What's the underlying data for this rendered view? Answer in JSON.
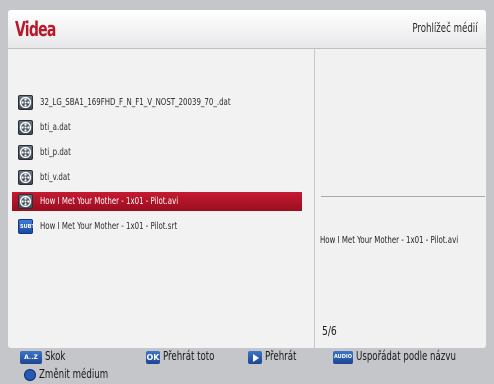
{
  "header": {
    "title": "Videa",
    "subtitle": "Prohlížeč médií"
  },
  "files": [
    {
      "name": "32_LG_SBA1_169FHD_F_N_F1_V_NOST_20039_70_.dat",
      "icon": "film-reel-icon",
      "selected": false
    },
    {
      "name": "bti_a.dat",
      "icon": "film-reel-icon",
      "selected": false
    },
    {
      "name": "bti_p.dat",
      "icon": "film-reel-icon",
      "selected": false
    },
    {
      "name": "bti_v.dat",
      "icon": "film-reel-icon",
      "selected": false
    },
    {
      "name": "How I Met Your Mother - 1x01 - Pilot.avi",
      "icon": "film-reel-icon",
      "selected": true
    },
    {
      "name": "How I Met Your Mother - 1x01 - Pilot.srt",
      "icon": "subtitle-icon",
      "selected": false
    }
  ],
  "subtitle_icon_text": "SUBT",
  "preview": {
    "name": "How I Met Your Mother - 1x01 - Pilot.avi",
    "counter": "5/6"
  },
  "footer": {
    "skip_badge": "A..Z",
    "skip_label": "Skok",
    "ok_badge": "OK",
    "play_this_label": "Přehrát toto",
    "play_label": "Přehrát",
    "audio_badge": "AUDIO",
    "sort_label": "Uspořádat podle názvu",
    "change_media_label": "Změnit médium"
  },
  "colors": {
    "accent": "#b8182a",
    "selection": "#b31326",
    "badge_blue": "#2a5cb0"
  }
}
